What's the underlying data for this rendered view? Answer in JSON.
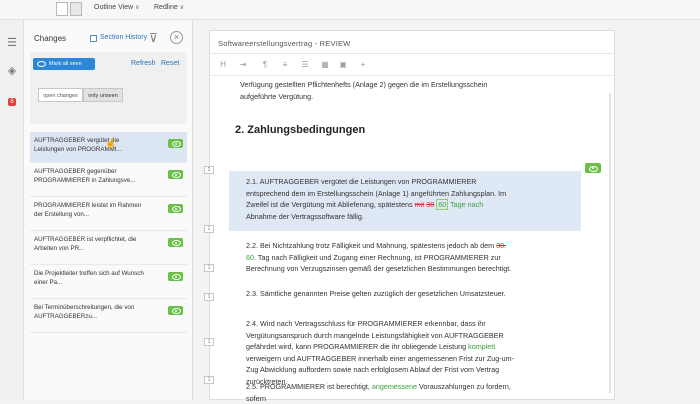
{
  "topbar": {
    "outline_view": "Outline View",
    "redline": "Redline"
  },
  "changes_panel": {
    "title": "Changes",
    "section_history": "Section History",
    "mark_all_seen": "Mark all seen",
    "refresh": "Refresh",
    "reset": "Reset",
    "filter_open": "open changes",
    "filter_unseen": "only unseen",
    "items": [
      {
        "text": "AUFTRAGGEBER vergütet die Leistungen von PROGRAMMI..."
      },
      {
        "text": "AUFTRAGGEBER gegenüber PROGRAMMIERER in Zahlungsve..."
      },
      {
        "text": "PROGRAMMIERER leistet im Rahmen der Erstellung von..."
      },
      {
        "text": "AUFTRAGGEBER ist verpflichtet, die Arbeiten von PR..."
      },
      {
        "text": "Die Projektleiter treffen sich auf Wunsch einer Pa..."
      },
      {
        "text": "Bei Terminüberschreitungen, die von AUFTRAGGEBERzu..."
      }
    ],
    "badge_count": "8"
  },
  "document": {
    "title": "Softwareerstellungsvertrag - REVIEW",
    "intro_line1": "Verfügung gestellten Pflichtenhefts (Anlage 2) gegen die im Erstellungsschein",
    "intro_line2": "aufgeführte Vergütung.",
    "heading": "2.  Zahlungsbedingungen",
    "p21_line1": "2.1.   AUFTRAGGEBER vergütet die Leistungen von PROGRAMMIERER",
    "p21_line2": "entsprechend dem im Erstellungsschein (Anlage 1) angeführten Zahlungsplan. Im",
    "p21_line3_a": "Zweifel ist die Vergütung mit Ablieferung, spätestens ",
    "p21_del1": "mit",
    "p21_del2": "30",
    "p21_ins1": "60",
    "p21_ins2": "Tage nach",
    "p21_line4": "Abnahme der Vertragssoftware fällig.",
    "p22_line1_a": "2.2.   Bei Nichtzahlung trotz Fälligkeit und Mahnung, spätestens jedoch ab dem ",
    "p22_del": "30.",
    "p22_ins": "60.",
    "p22_line2_b": " Tag nach Fälligkeit und Zugang einer Rechnung, ist PROGRAMMIERER zur",
    "p22_line3": "Berechnung von Verzugszinsen gemäß der gesetzlichen Bestimmungen berechtigt.",
    "p23": "2.3.   Sämtliche genannten Preise gelten zuzüglich der gesetzlichen Umsatzsteuer.",
    "p24_line1": "2.4.   Wird nach Vertragsschluss für PROGRAMMIERER erkennbar, dass ihr",
    "p24_line2": "Vergütungsanspruch durch mangelnde Leistungsfähigkeit von AUFTRAGGEBER",
    "p24_line3_a": "gefährdet wird, kann PROGRAMMIERER die ihr obliegende Leistung ",
    "p24_ins": "komplett",
    "p24_line4": "verweigern und AUFTRAGGEBER innerhalb einer angemessenen Frist zur Zug-um-",
    "p24_line5": "Zug Abwicklung auffordern sowie nach erfolglosem Ablauf der Frist vom Vertrag",
    "p24_line6": "zurücktreten.",
    "p25_line1_a": "2.5.   PROGRAMMIERER ist berechtigt, ",
    "p25_ins": "angemessene",
    "p25_line1_b": " Vorauszahlungen zu fordern,",
    "p25_line2": "sofern",
    "margin_marks": [
      "2",
      "1",
      "1",
      "1",
      "1",
      "1"
    ]
  }
}
